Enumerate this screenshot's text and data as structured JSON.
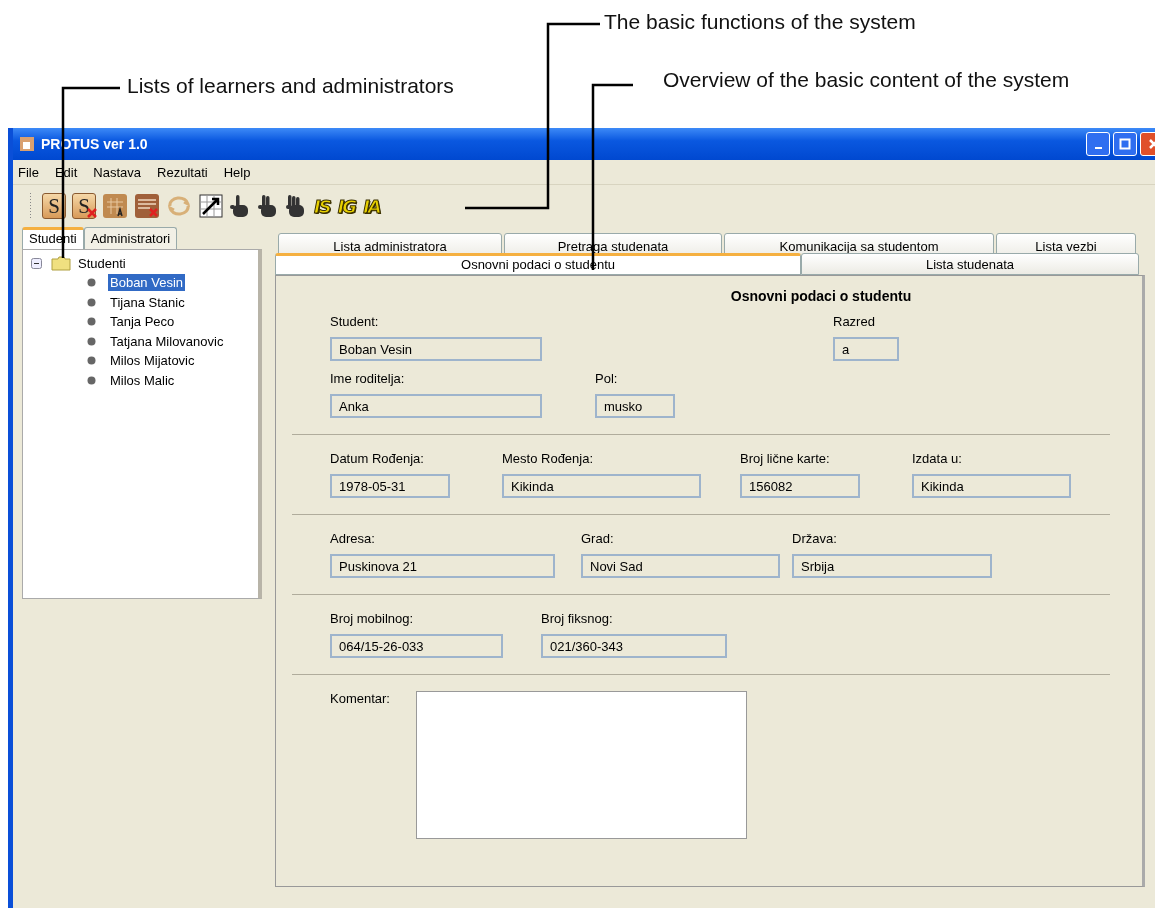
{
  "callouts": [
    {
      "text": "Lists of learners and administrators"
    },
    {
      "text": "The basic functions of the system"
    },
    {
      "text": "Overview of the basic content of the system"
    }
  ],
  "window": {
    "title": "PROTUS ver 1.0"
  },
  "menu": [
    "File",
    "Edit",
    "Nastava",
    "Rezultati",
    "Help"
  ],
  "toolbar": [
    {
      "kind": "s-card",
      "label": "S"
    },
    {
      "kind": "s-card-x",
      "label": "S"
    },
    {
      "kind": "grid-a"
    },
    {
      "kind": "list-x"
    },
    {
      "kind": "cycle"
    },
    {
      "kind": "chart-arrow"
    },
    {
      "kind": "hand-one"
    },
    {
      "kind": "hand-two"
    },
    {
      "kind": "hand-three"
    },
    {
      "kind": "yellow-letters",
      "label": "IS"
    },
    {
      "kind": "yellow-letters",
      "label": "IG"
    },
    {
      "kind": "yellow-letters",
      "label": "IA"
    }
  ],
  "left_tabs": [
    {
      "label": "Studenti",
      "selected": true
    },
    {
      "label": "Administratori",
      "selected": false
    }
  ],
  "tree": {
    "label": "Studenti",
    "expanded": true,
    "children": [
      {
        "label": "Boban Vesin",
        "selected": true
      },
      {
        "label": "Tijana Stanic",
        "selected": false
      },
      {
        "label": "Tanja Peco",
        "selected": false
      },
      {
        "label": "Tatjana Milovanovic",
        "selected": false
      },
      {
        "label": "Milos Mijatovic",
        "selected": false
      },
      {
        "label": "Milos Malic",
        "selected": false
      }
    ]
  },
  "tabs_back": [
    {
      "label": "Lista administratora"
    },
    {
      "label": "Pretraga studenata"
    },
    {
      "label": "Komunikacija sa studentom"
    },
    {
      "label": "Lista vezbi"
    }
  ],
  "tabs_front": [
    {
      "label": "Osnovni podaci o studentu",
      "selected": true
    },
    {
      "label": "Lista studenata",
      "selected": false
    }
  ],
  "form": {
    "heading": "Osnovni podaci o studentu",
    "sections": [
      {
        "rows": [
          [
            {
              "label": "Student:",
              "value": "Boban Vesin"
            },
            {
              "label": "Razred",
              "value": "a"
            }
          ],
          [
            {
              "label": "Ime roditelja:",
              "value": "Anka"
            },
            {
              "label": "Pol:",
              "value": "musko"
            }
          ]
        ]
      },
      {
        "rows": [
          [
            {
              "label": "Datum Rođenja:",
              "value": "1978-05-31"
            },
            {
              "label": "Mesto Rođenja:",
              "value": "Kikinda"
            },
            {
              "label": "Broj lične karte:",
              "value": "156082"
            },
            {
              "label": "Izdata u:",
              "value": "Kikinda"
            }
          ]
        ]
      },
      {
        "rows": [
          [
            {
              "label": "Adresa:",
              "value": "Puskinova 21"
            },
            {
              "label": "Grad:",
              "value": "Novi Sad"
            },
            {
              "label": "Država:",
              "value": "Srbija"
            }
          ]
        ]
      },
      {
        "rows": [
          [
            {
              "label": "Broj mobilnog:",
              "value": "064/15-26-033"
            },
            {
              "label": "Broj fiksnog:",
              "value": "021/360-343"
            }
          ]
        ]
      }
    ],
    "comment": {
      "label": "Komentar:"
    }
  }
}
